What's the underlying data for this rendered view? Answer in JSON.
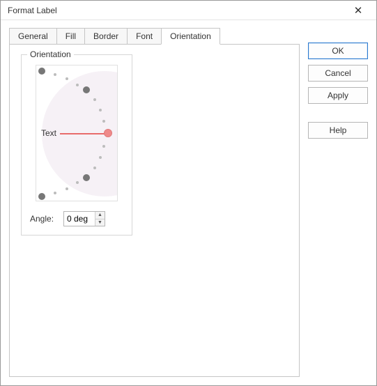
{
  "window": {
    "title": "Format Label"
  },
  "tabs": {
    "general": "General",
    "fill": "Fill",
    "border": "Border",
    "font": "Font",
    "orientation": "Orientation"
  },
  "orientation": {
    "group_label": "Orientation",
    "preview_text": "Text",
    "angle_label": "Angle:",
    "angle_value": "0 deg"
  },
  "buttons": {
    "ok": "OK",
    "cancel": "Cancel",
    "apply": "Apply",
    "help": "Help"
  }
}
